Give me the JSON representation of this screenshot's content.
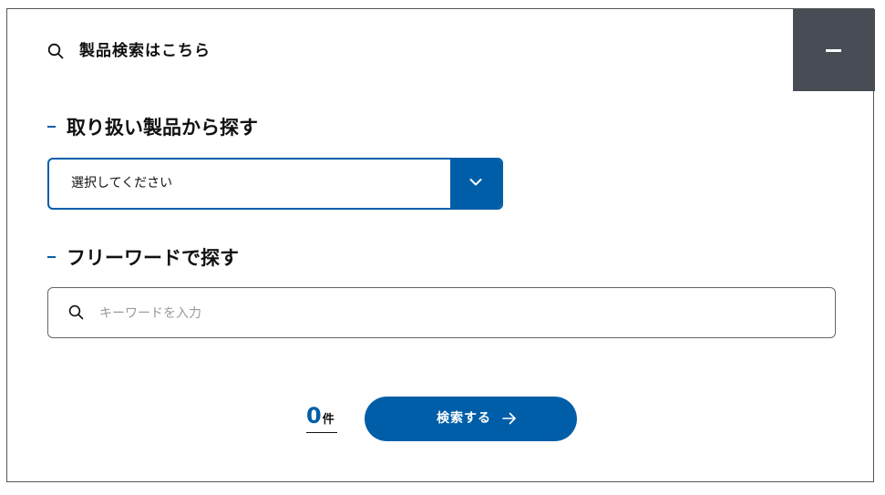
{
  "header": {
    "title": "製品検索はこちら",
    "search_icon": "search-icon",
    "collapse_icon": "minus-icon"
  },
  "product_section": {
    "heading": "取り扱い製品から探す",
    "select": {
      "selected_value": "選択してください",
      "arrow_icon": "chevron-down-icon"
    }
  },
  "keyword_section": {
    "heading": "フリーワードで探す",
    "input": {
      "placeholder": "キーワードを入力",
      "value": "",
      "icon": "search-icon"
    }
  },
  "results": {
    "count": "0",
    "count_unit": "件"
  },
  "search_button": {
    "label": "検索する",
    "icon": "arrow-right-icon"
  },
  "colors": {
    "accent": "#005ea8",
    "collapse_bg": "#484c54",
    "border": "#555555",
    "placeholder": "#9a9a9a"
  }
}
